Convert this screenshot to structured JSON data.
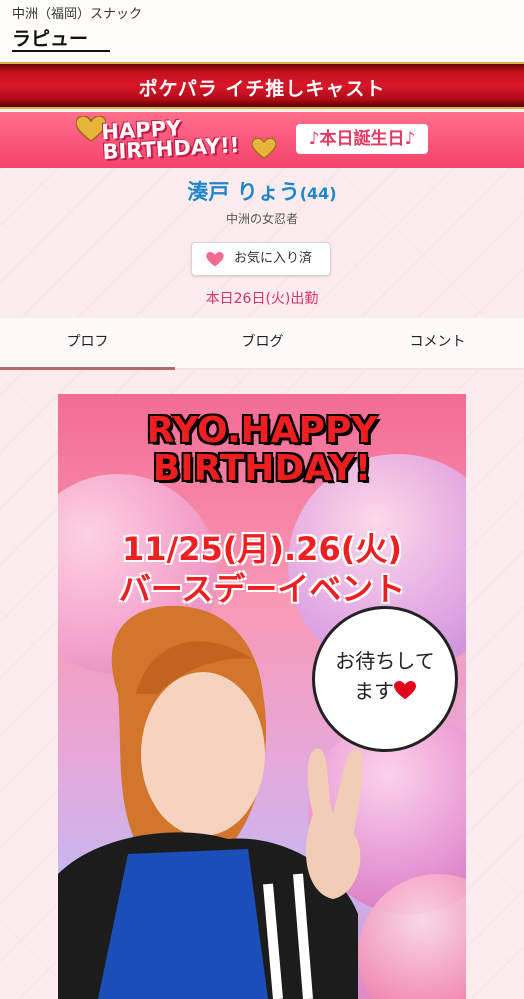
{
  "header": {
    "area": "中洲（福岡）スナック",
    "shop_name": "ラピュー"
  },
  "banner": {
    "title": "ポケパラ イチ推しキャスト"
  },
  "birthday": {
    "logo_line1": "HAPPY",
    "logo_line2": "BIRTHDAY!!",
    "badge": "♪本日誕生日♪"
  },
  "cast": {
    "name": "湊戸 りょう",
    "age": "(44)",
    "catchphrase": "中洲の女忍者",
    "favorite_label": "お気に入り済",
    "shift": "本日26日(火)出勤"
  },
  "tabs": [
    {
      "label": "プロフ",
      "active": true
    },
    {
      "label": "ブログ",
      "active": false
    },
    {
      "label": "コメント",
      "active": false
    }
  ],
  "photo": {
    "title_line1": "RYO.HAPPY",
    "title_line2": "BIRTHDAY!",
    "date": "11/25(月).26(火)",
    "event": "バースデーイベント",
    "bubble_line1": "お待ちして",
    "bubble_line2": "ます"
  },
  "colors": {
    "accent_pink": "#f4426c",
    "name_blue": "#1e86c9",
    "shift_pink": "#d6336c",
    "banner_red": "#d9182a"
  }
}
